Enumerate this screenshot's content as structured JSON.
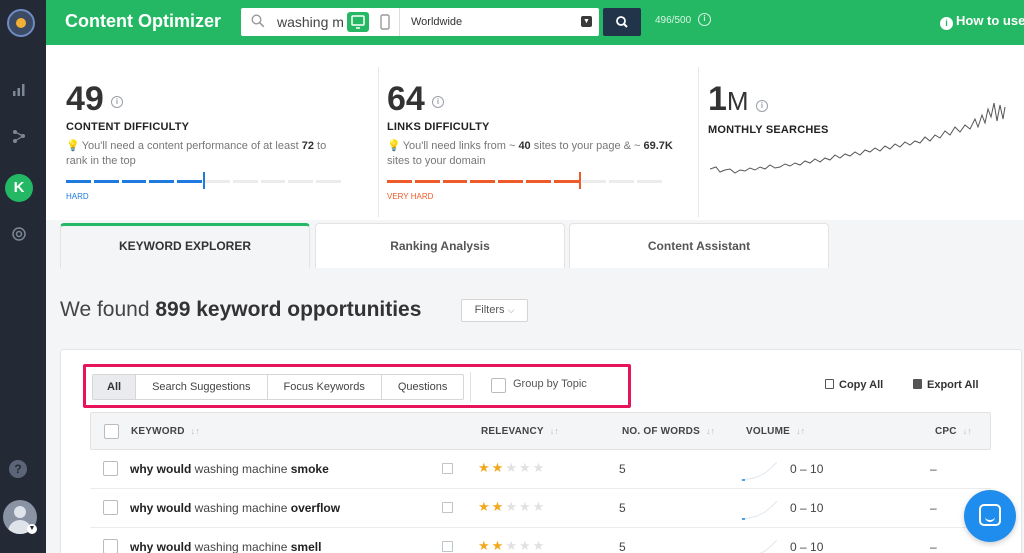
{
  "app": {
    "title": "Content Optimizer"
  },
  "search": {
    "query": "washing m",
    "location": "Worldwide",
    "quota": "496/500"
  },
  "header": {
    "how_to": "How to use"
  },
  "metrics": {
    "content": {
      "value": "49",
      "label": "CONTENT DIFFICULTY",
      "desc_pre": "You'll need a content performance of at least ",
      "desc_num": "72",
      "desc_post": " to rank in the top",
      "level": "HARD",
      "filled": 5,
      "total": 10,
      "color": "#1f7ae0"
    },
    "links": {
      "value": "64",
      "label": "LINKS DIFFICULTY",
      "desc_pre": "You'll need links from ~ ",
      "desc_num1": "40",
      "desc_mid": " sites to your page & ~ ",
      "desc_num2": "69.7K",
      "desc_post": " sites to your domain",
      "level": "VERY HARD",
      "filled": 7,
      "total": 10,
      "color": "#ef5a2a"
    },
    "searches": {
      "value": "1",
      "unit": "M",
      "label": "MONTHLY SEARCHES"
    }
  },
  "tabs": [
    {
      "label": "KEYWORD EXPLORER",
      "active": true
    },
    {
      "label": "Ranking Analysis",
      "active": false
    },
    {
      "label": "Content Assistant",
      "active": false
    }
  ],
  "results": {
    "prefix": "We found ",
    "count": "899",
    "suffix": " keyword opportunities",
    "filters_label": "Filters"
  },
  "segments": [
    "All",
    "Search Suggestions",
    "Focus Keywords",
    "Questions"
  ],
  "group_by_topic": "Group by Topic",
  "actions": {
    "copy_all": "Copy All",
    "export_all": "Export All"
  },
  "columns": {
    "keyword": "KEYWORD",
    "relevancy": "RELEVANCY",
    "words": "NO. OF WORDS",
    "volume": "VOLUME",
    "cpc": "CPC"
  },
  "rows": [
    {
      "kw_a": "why would",
      "kw_b": " washing machine ",
      "kw_c": "smoke",
      "stars": 2,
      "words": "5",
      "volume": "0 – 10",
      "cpc": "–"
    },
    {
      "kw_a": "why would",
      "kw_b": " washing machine ",
      "kw_c": "overflow",
      "stars": 2,
      "words": "5",
      "volume": "0 – 10",
      "cpc": "–"
    },
    {
      "kw_a": "why would",
      "kw_b": " washing machine ",
      "kw_c": "smell",
      "stars": 2,
      "words": "5",
      "volume": "0 – 10",
      "cpc": "–"
    }
  ],
  "colors": {
    "brand": "#25b864",
    "sidebar": "#232a36",
    "highlight": "#e8145a",
    "chat": "#1f8ded"
  }
}
